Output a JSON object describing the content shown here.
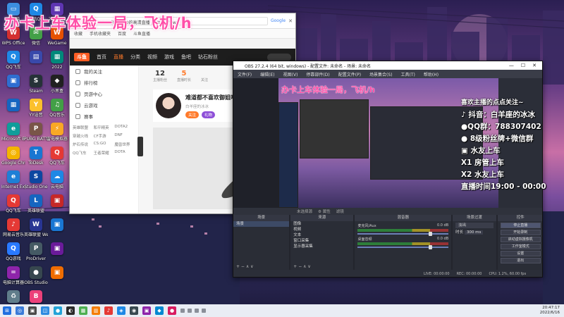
{
  "overlay_title": "办卡上车体验一局，飞机/h",
  "desktop_icons": [
    {
      "label": "此电脑",
      "color": "#3c8ee0",
      "glyph": "▭"
    },
    {
      "label": "WPS Office",
      "color": "#d32f2f",
      "glyph": "W"
    },
    {
      "label": "QQ飞车",
      "color": "#1e88e5",
      "glyph": "Q"
    },
    {
      "label": "",
      "color": "#2f6ed1",
      "glyph": "▣"
    },
    {
      "label": "",
      "color": "#1565c0",
      "glyph": "▦"
    },
    {
      "label": "Microsoft Edge",
      "color": "#0f9d9a",
      "glyph": "e"
    },
    {
      "label": "Google Chrome",
      "color": "#f4b400",
      "glyph": "◎"
    },
    {
      "label": "Internet Explorer",
      "color": "#1e7fd6",
      "glyph": "e"
    },
    {
      "label": "QQ飞车",
      "color": "#e53935",
      "glyph": "Q"
    },
    {
      "label": "网易云音乐",
      "color": "#e53935",
      "glyph": "♪"
    },
    {
      "label": "QQ游戏",
      "color": "#2979ff",
      "glyph": "Q"
    },
    {
      "label": "电脑计算器",
      "color": "#8e24aa",
      "glyph": "="
    },
    {
      "label": "回收站",
      "color": "#607d8b",
      "glyph": "♻"
    },
    {
      "label": "腾讯QQ",
      "color": "#1e88e5",
      "glyph": "Q"
    },
    {
      "label": "微信",
      "color": "#43a047",
      "glyph": "✉"
    },
    {
      "label": "",
      "color": "#3949ab",
      "glyph": "▤"
    },
    {
      "label": "Steam",
      "color": "#263238",
      "glyph": "S"
    },
    {
      "label": "YY语音",
      "color": "#fbc02d",
      "glyph": "Y"
    },
    {
      "label": "PUBG BATTLEGR.",
      "color": "#795548",
      "glyph": "P"
    },
    {
      "label": "ToDesk",
      "color": "#1976d2",
      "glyph": "T"
    },
    {
      "label": "Studio One",
      "color": "#0d47a1",
      "glyph": "S"
    },
    {
      "label": "英雄联盟",
      "color": "#1565c0",
      "glyph": "L"
    },
    {
      "label": "英雄联盟 WeGame版",
      "color": "#283593",
      "glyph": "W"
    },
    {
      "label": "ProDriver",
      "color": "#455a64",
      "glyph": "P"
    },
    {
      "label": "OBS Studio",
      "color": "#37474f",
      "glyph": "●"
    },
    {
      "label": "BiliBili",
      "color": "#ec407a",
      "glyph": "B"
    },
    {
      "label": "2021-12",
      "color": "#5e35b1",
      "glyph": "▦"
    },
    {
      "label": "WeGame",
      "color": "#e65100",
      "glyph": "W"
    },
    {
      "label": "2022",
      "color": "#00897b",
      "glyph": "▦"
    },
    {
      "label": "小黑盒",
      "color": "#212121",
      "glyph": "◆"
    },
    {
      "label": "QQ音乐",
      "color": "#43a047",
      "glyph": "♫"
    },
    {
      "label": "雷电模拟器",
      "color": "#f9a825",
      "glyph": "⚡"
    },
    {
      "label": "QQ飞车",
      "color": "#e53935",
      "glyph": "Q"
    },
    {
      "label": "云电脑",
      "color": "#1e88e5",
      "glyph": "☁"
    },
    {
      "label": "",
      "color": "#c62828",
      "glyph": "▣"
    },
    {
      "label": "",
      "color": "#1976d2",
      "glyph": "▣"
    },
    {
      "label": "",
      "color": "#6a1b9a",
      "glyph": "▣"
    },
    {
      "label": "",
      "color": "#ef6c00",
      "glyph": "▣"
    }
  ],
  "browser": {
    "tab_title": "Google",
    "url": "a315.1.来自ARIO的高清直播 | https://www",
    "bookmarks": [
      "收藏",
      "手机收藏夹",
      "百度",
      "斗鱼直播"
    ],
    "nav": [
      "首页",
      "直播",
      "分类",
      "视频",
      "游戏",
      "鱼吧",
      "钻石粉丝"
    ],
    "sidebar": [
      "我的关注",
      "排行榜",
      "页游中心",
      "云游戏",
      "赛事"
    ],
    "sidebar_grid": [
      "英雄联盟",
      "和平精英",
      "DOTA2",
      "穿越火线",
      "CF手游",
      "DNF",
      "炉石传说",
      "CS:GO",
      "魔兽世界",
      "QQ飞车",
      "王者荣耀",
      "DOTA"
    ],
    "stats": [
      {
        "num": "12",
        "cap": "主播粉丝"
      },
      {
        "num": "5",
        "cap": "直播时长"
      },
      {
        "num": "",
        "cap": "关注"
      }
    ],
    "room_title": "难道都不喜欢御姐吗",
    "room_sub": "白羊座的冰冰",
    "pill_follow": "关注",
    "pill_gift": "礼物",
    "side_arrow": "‹"
  },
  "obs": {
    "title": "OBS 27.2.4 (64 bit, windows) - 配置文件: 未命名 - 场景: 未命名",
    "menu": [
      "文件(F)",
      "编辑(E)",
      "视图(V)",
      "停靠部件(D)",
      "配置文件(P)",
      "场景集合(S)",
      "工具(T)",
      "帮助(H)"
    ],
    "window_controls": [
      "—",
      "☐",
      "✕"
    ],
    "preview_title": "办卡上车体验一局，飞机/h",
    "toolbar": [
      "未选择源",
      "⚙ 属性",
      "滤镜"
    ],
    "docks": {
      "scenes": {
        "title": "场景",
        "items": [
          "场景"
        ]
      },
      "sources": {
        "title": "来源",
        "items": [
          "图像",
          "视频",
          "文本",
          "窗口采集",
          "显示器采集"
        ]
      },
      "mixer": {
        "title": "混音器",
        "channels": [
          {
            "name": "麦克风/Aux",
            "db": "0.0 dB"
          },
          {
            "name": "桌面音频",
            "db": "0.0 dB"
          }
        ]
      },
      "transitions": {
        "title": "场景过渡",
        "type": "淡出",
        "duration_label": "时长",
        "duration": "300 ms"
      },
      "controls": {
        "title": "控件",
        "buttons": [
          "停止直播",
          "开始录制",
          "启动虚拟摄像机",
          "工作室模式",
          "设置",
          "退出"
        ]
      }
    },
    "dock_footer": "+  −  ∧  ∨",
    "status": [
      "LIVE: 00:00:00",
      "REC: 00:00:00",
      "CPU: 1.2%, 60.00 fps"
    ]
  },
  "right_overlay": [
    "喜欢主播的点点关注~",
    "♪ 抖音：白羊座的冰冰",
    "●QQ群：788307402",
    "● 8级粉丝牌+微信群",
    "▣ 水友上车",
    "X1 房管上车",
    "X2 水友上车",
    "直播时间19:00 - 00:00"
  ],
  "taskbar": {
    "apps": [
      "⊞",
      "◎",
      "▣",
      "◫",
      "●",
      "◐",
      "▦",
      "▥",
      "♪",
      "◈",
      "◉",
      "▣",
      "◆",
      "●"
    ],
    "clock_time": "20:47:17",
    "clock_date": "2022/6/16"
  }
}
